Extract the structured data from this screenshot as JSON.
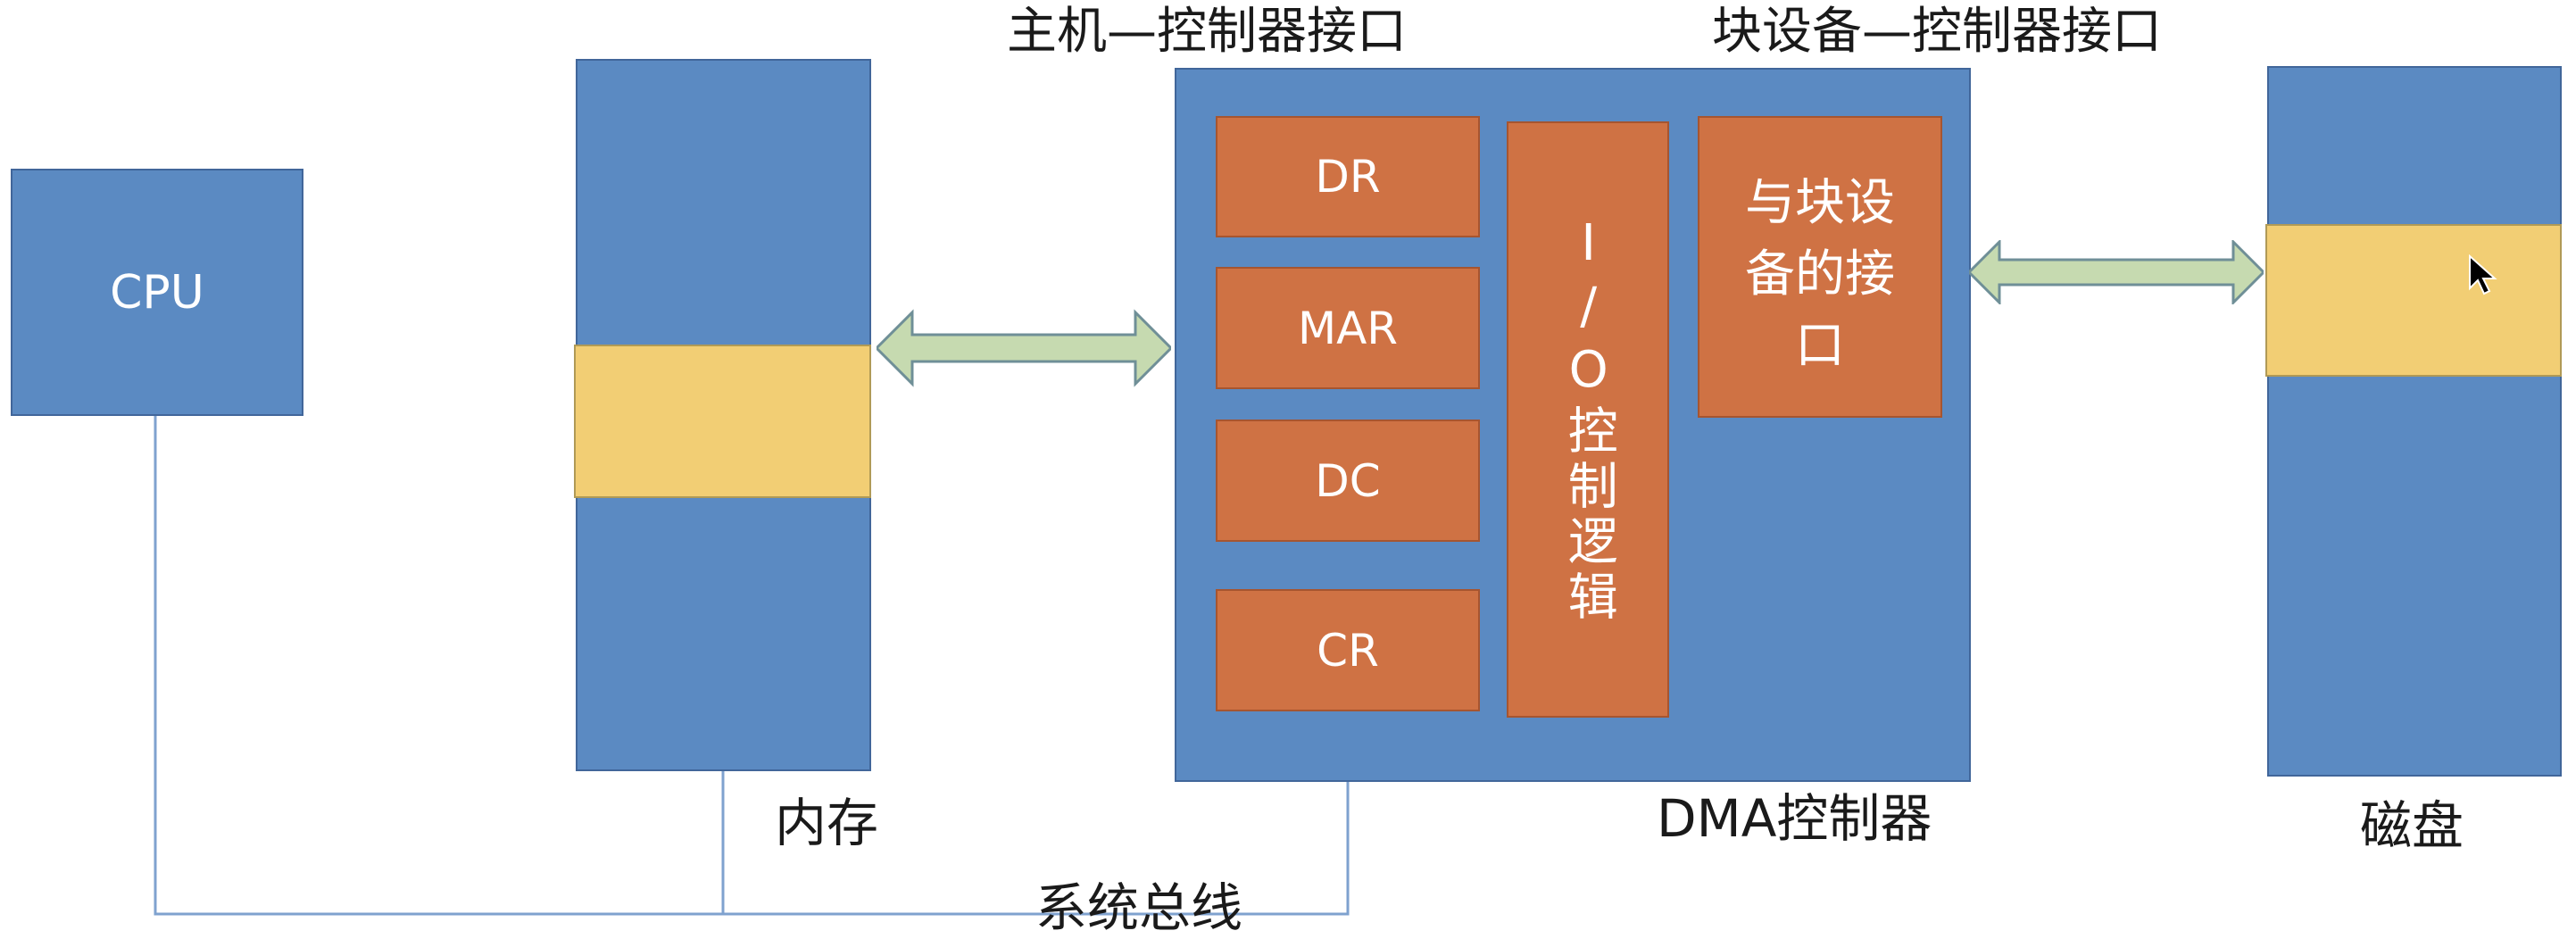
{
  "labels": {
    "cpu": "CPU",
    "memory": "内存",
    "dma_controller": "DMA控制器",
    "disk": "磁盘",
    "system_bus": "系统总线",
    "host_interface": "主机—控制器接口",
    "block_device_interface": "块设备—控制器接口"
  },
  "registers": {
    "dr": "DR",
    "mar": "MAR",
    "dc": "DC",
    "cr": "CR"
  },
  "io_logic": "I/O控制逻辑",
  "block_interface": {
    "line1": "与块设",
    "line2": "备的接",
    "line3": "口"
  },
  "colors": {
    "blue": "#5b8ac2",
    "orange": "#cf7244",
    "yellow": "#f2ce74",
    "arrow": "#c6dab0",
    "bus": "#7fa2cf"
  },
  "icons": [
    "bidirectional-arrow-icon",
    "mouse-cursor-icon"
  ]
}
